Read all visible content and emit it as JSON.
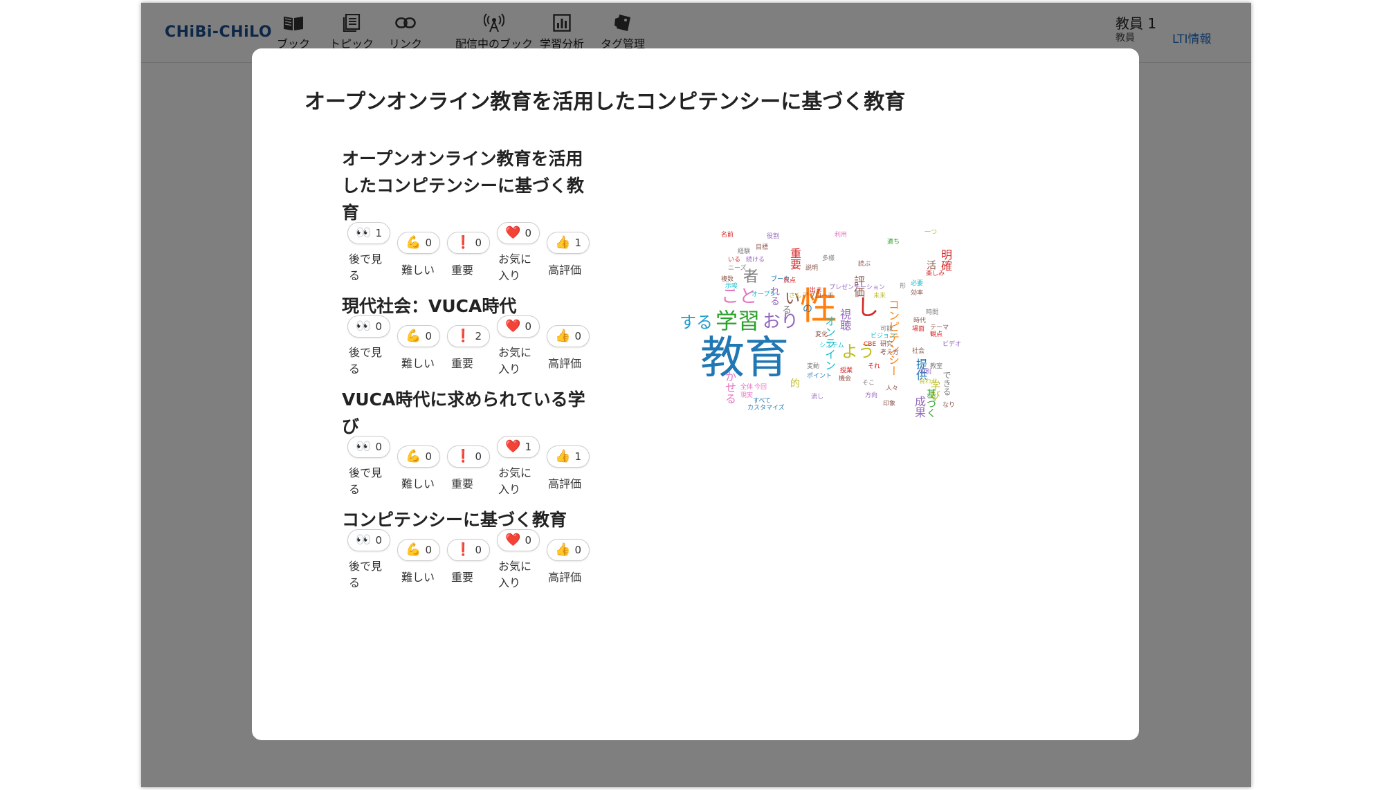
{
  "app": {
    "logo": "CHiBi-CHiLO",
    "nav": [
      {
        "label": "ブック",
        "icon": "book-icon"
      },
      {
        "label": "トピック",
        "icon": "topic-list-icon"
      },
      {
        "label": "リンク",
        "icon": "link-icon"
      },
      {
        "label": "配信中のブック",
        "icon": "broadcast-icon"
      },
      {
        "label": "学習分析",
        "icon": "bar-chart-icon"
      },
      {
        "label": "タグ管理",
        "icon": "tag-icon"
      }
    ],
    "user": {
      "name": "教員 1",
      "role": "教員",
      "lti_link": "LTI情報"
    }
  },
  "modal": {
    "title": "オープンオンライン教育を活用したコンピテンシーに基づく教育",
    "reaction_labels": [
      "後で見る",
      "難しい",
      "重要",
      "お気に入り",
      "高評価"
    ],
    "reaction_icons": [
      "eyes-icon",
      "flexed-biceps-icon",
      "exclamation-icon",
      "heart-icon",
      "thumbs-up-icon"
    ],
    "reaction_emojis": [
      "👀",
      "💪",
      "❗",
      "❤️",
      "👍"
    ],
    "topics": [
      {
        "title": "オープンオンライン教育を活用したコンピテンシーに基づく教育",
        "counts": [
          1,
          0,
          0,
          0,
          1
        ]
      },
      {
        "title": "現代社会：VUCA時代",
        "counts": [
          0,
          0,
          2,
          0,
          0
        ]
      },
      {
        "title": "VUCA時代に求められている学び",
        "counts": [
          0,
          0,
          0,
          1,
          1
        ]
      },
      {
        "title": "コンピテンシーに基づく教育",
        "counts": [
          0,
          0,
          0,
          0,
          0
        ]
      }
    ],
    "word_cloud": {
      "big": [
        "教育",
        "性",
        "学習",
        "する",
        "こと",
        "おり",
        "い",
        "者",
        "し",
        "よう",
        "評価",
        "視聴",
        "オンライン",
        "コンピテンシー",
        "提供",
        "成果",
        "学び",
        "基づく",
        "できる",
        "明確",
        "活",
        "重要",
        "かせる",
        "れる",
        "の",
        "る",
        "的"
      ],
      "small": [
        "名前",
        "役割",
        "利用",
        "一つ",
        "適ち",
        "目標",
        "経験",
        "いる",
        "続ける",
        "多様",
        "説明",
        "読ぶ",
        "ニーズ",
        "複数",
        "示唆",
        "ブーカ",
        "楽しみ",
        "時間",
        "出ま",
        "焦点",
        "オープン",
        "さん",
        "アプローチ",
        "プレゼンテーション",
        "必要",
        "効率",
        "形",
        "未来",
        "時代",
        "変化",
        "ビジョン",
        "テーマ",
        "観点",
        "ビデオ",
        "可能",
        "場面",
        "CBE",
        "研究",
        "社会",
        "考え方",
        "システム",
        "授業",
        "変動",
        "ポイント",
        "機会",
        "そこ",
        "それ",
        "全体",
        "合わせ",
        "個別",
        "現実",
        "すべて",
        "今回",
        "人々",
        "方向",
        "流し",
        "印象",
        "なり",
        "カスタマイズ",
        "教室",
        "現代",
        "活用",
        "一般"
      ]
    }
  }
}
